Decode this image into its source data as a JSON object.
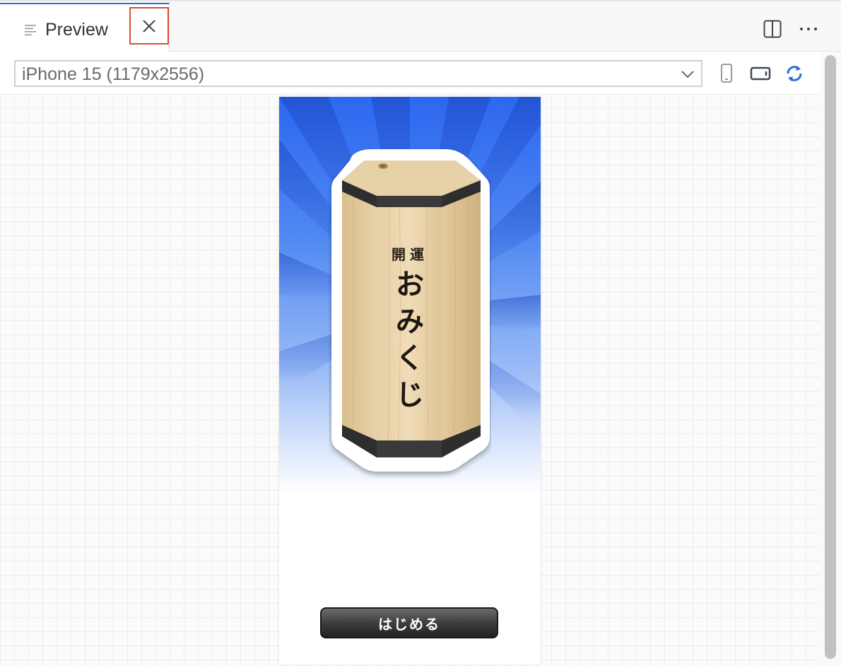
{
  "tab": {
    "label": "Preview"
  },
  "toolbar": {
    "device": "iPhone 15 (1179x2556)"
  },
  "phone": {
    "box_label_top": "開運",
    "box_label_main": [
      "お",
      "み",
      "く",
      "じ"
    ],
    "start_button": "はじめる"
  },
  "colors": {
    "accent": "#2f6fd6",
    "close_highlight": "#e14b32",
    "sky_top": "#2c67f0",
    "rotate_icon": "#2f6fd6"
  }
}
